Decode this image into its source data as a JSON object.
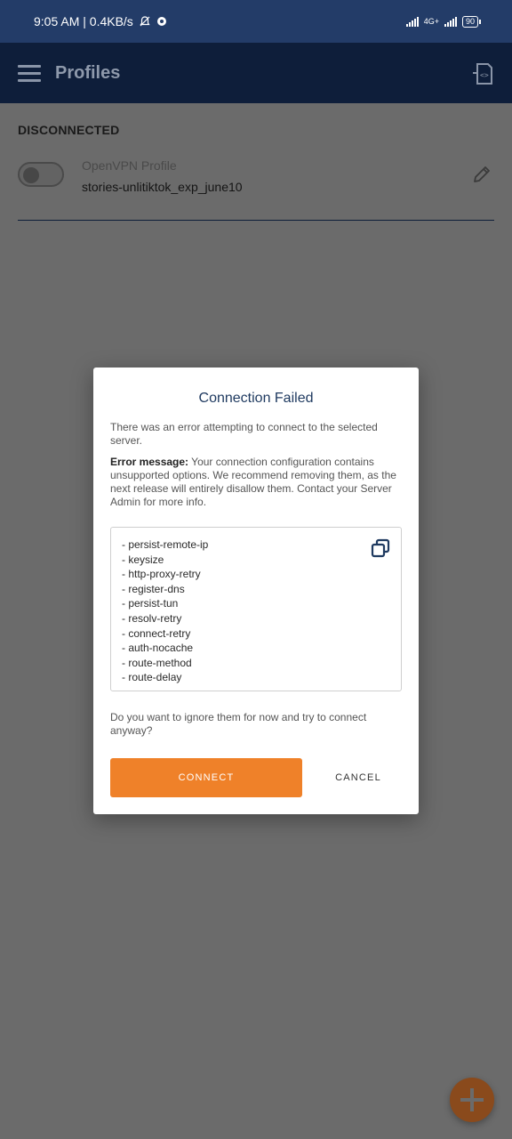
{
  "status_bar": {
    "time_speed": "9:05 AM | 0.4KB/s",
    "network_label": "4G+",
    "battery": "90"
  },
  "app_bar": {
    "title": "Profiles"
  },
  "profiles": {
    "state_label": "DISCONNECTED",
    "profile_type": "OpenVPN Profile",
    "profile_name": "stories-unlitiktok_exp_june10"
  },
  "dialog": {
    "title": "Connection Failed",
    "intro": "There was an error attempting to connect to the selected server.",
    "error_label": "Error message:",
    "error_text": "Your connection configuration contains unsupported options. We recommend removing them, as the next release will entirely disallow them. Contact your Server Admin for more info.",
    "options": [
      "- persist-remote-ip",
      "- keysize",
      "- http-proxy-retry",
      "- register-dns",
      "- persist-tun",
      "- resolv-retry",
      "- connect-retry",
      "- auth-nocache",
      "- route-method",
      "- route-delay"
    ],
    "question": "Do you want to ignore them for now and try to connect anyway?",
    "connect_label": "CONNECT",
    "cancel_label": "CANCEL"
  },
  "colors": {
    "status_bar": "#233c68",
    "app_bar": "#0e1e3a",
    "accent": "#ef8129",
    "dialog_title": "#1f3a60"
  }
}
